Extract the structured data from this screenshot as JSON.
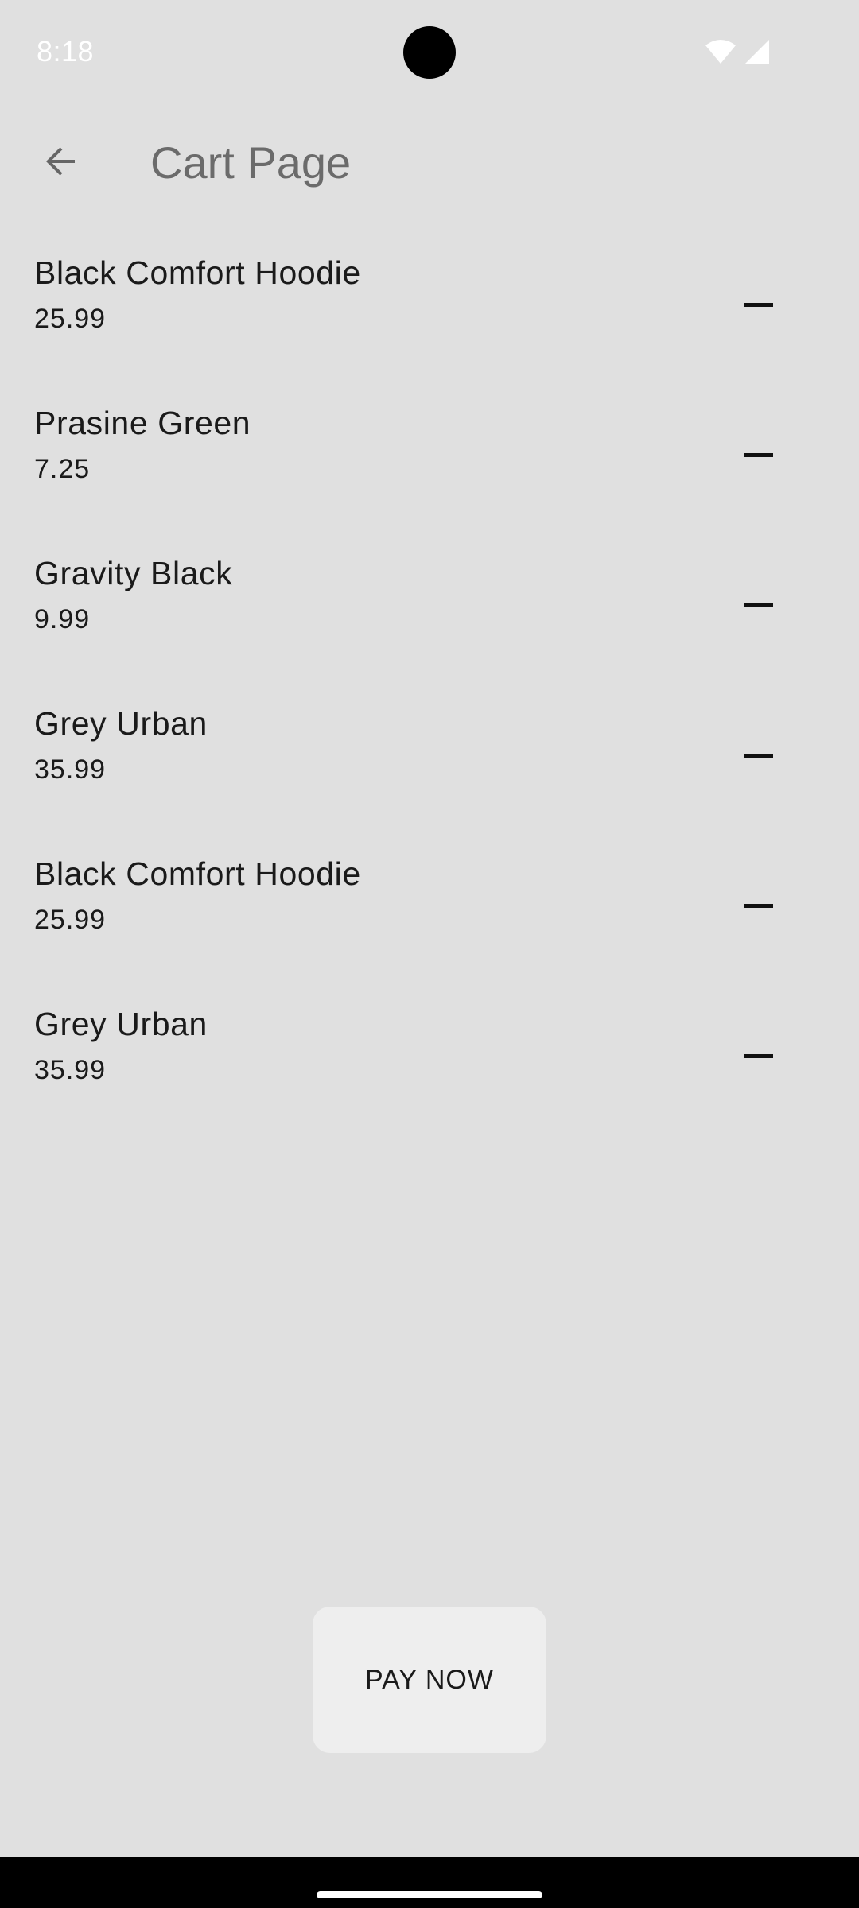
{
  "status_bar": {
    "time": "8:18",
    "icons": [
      "wifi-icon",
      "cellular-signal-icon"
    ]
  },
  "app_bar": {
    "back_icon": "arrow-back-icon",
    "title": "Cart Page"
  },
  "cart": {
    "items": [
      {
        "name": "Black Comfort Hoodie",
        "price": "25.99"
      },
      {
        "name": "Prasine Green",
        "price": "7.25"
      },
      {
        "name": "Gravity Black",
        "price": "9.99"
      },
      {
        "name": "Grey Urban",
        "price": "35.99"
      },
      {
        "name": "Black Comfort Hoodie",
        "price": "25.99"
      },
      {
        "name": "Grey Urban",
        "price": "35.99"
      }
    ],
    "remove_icon": "remove-icon"
  },
  "pay_button": {
    "label": "PAY NOW"
  },
  "colors": {
    "background": "#e0e0e0",
    "title_text": "#6b6b6b",
    "body_text": "#1a1a1a",
    "button_surface": "#eeeeee",
    "nav_bar": "#000000"
  }
}
